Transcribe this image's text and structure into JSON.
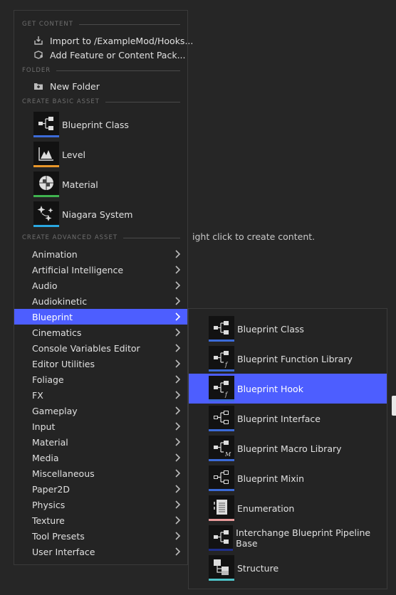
{
  "background": {
    "hint": "ight click to create content."
  },
  "menu": {
    "sections": {
      "get_content": "GET CONTENT",
      "folder": "FOLDER",
      "basic": "CREATE BASIC ASSET",
      "advanced": "CREATE ADVANCED ASSET"
    },
    "get_content_items": [
      {
        "label": "Import to /ExampleMod/Hooks...",
        "icon": "import-icon"
      },
      {
        "label": "Add Feature or Content Pack...",
        "icon": "content-pack-icon"
      }
    ],
    "folder_items": [
      {
        "label": "New Folder",
        "icon": "new-folder-icon"
      }
    ],
    "basic_assets": [
      {
        "label": "Blueprint Class",
        "icon": "blueprint-class-icon",
        "color": "#3c6bd8"
      },
      {
        "label": "Level",
        "icon": "level-icon",
        "color": "#e8962a"
      },
      {
        "label": "Material",
        "icon": "material-icon",
        "color": "#3fb34f"
      },
      {
        "label": "Niagara System",
        "icon": "niagara-system-icon",
        "color": "#2aa7e0"
      }
    ],
    "categories": [
      "Animation",
      "Artificial Intelligence",
      "Audio",
      "Audiokinetic",
      "Blueprint",
      "Cinematics",
      "Console Variables Editor",
      "Editor Utilities",
      "Foliage",
      "FX",
      "Gameplay",
      "Input",
      "Material",
      "Media",
      "Miscellaneous",
      "Paper2D",
      "Physics",
      "Texture",
      "Tool Presets",
      "User Interface"
    ],
    "selected_category": "Blueprint"
  },
  "submenu": {
    "items": [
      {
        "label": "Blueprint Class",
        "icon": "blueprint-class-icon",
        "color": "#3c6bd8"
      },
      {
        "label": "Blueprint Function Library",
        "icon": "blueprint-function-library-icon",
        "color": "#3c6bd8"
      },
      {
        "label": "Blueprint Hook",
        "icon": "blueprint-hook-icon",
        "color": "#3c6bd8"
      },
      {
        "label": "Blueprint Interface",
        "icon": "blueprint-interface-icon",
        "color": "#3c6bd8"
      },
      {
        "label": "Blueprint Macro Library",
        "icon": "blueprint-macro-library-icon",
        "color": "#3c6bd8"
      },
      {
        "label": "Blueprint Mixin",
        "icon": "blueprint-mixin-icon",
        "color": "#3c6bd8"
      },
      {
        "label": "Enumeration",
        "icon": "enumeration-icon",
        "color": "#e89a9a"
      },
      {
        "label": "Interchange Blueprint Pipeline Base",
        "icon": "interchange-pipeline-icon",
        "color": "#1f2f8a"
      },
      {
        "label": "Structure",
        "icon": "structure-icon",
        "color": "#4fc3c8"
      }
    ],
    "selected": "Blueprint Hook"
  }
}
